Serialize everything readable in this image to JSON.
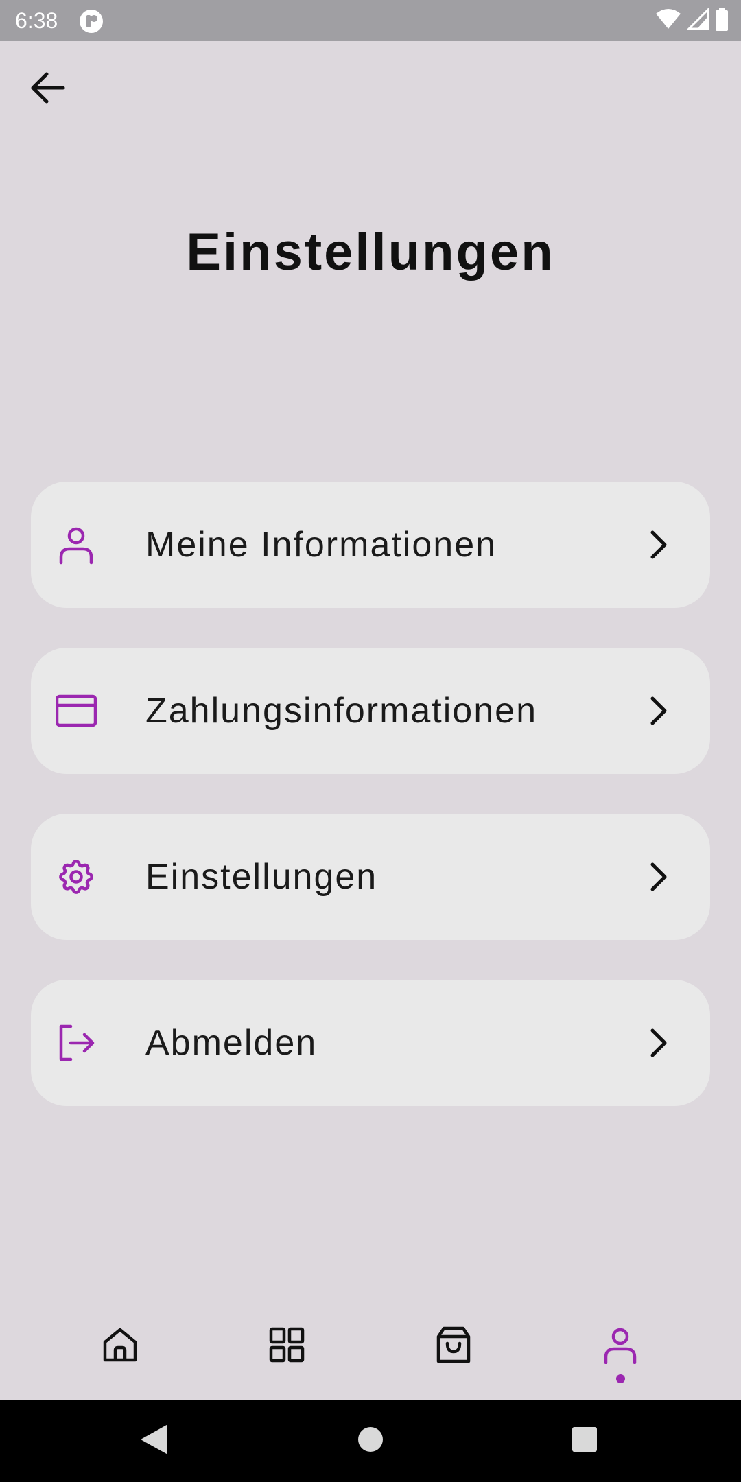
{
  "status_bar": {
    "time": "6:38",
    "icons": [
      "app-notification-icon",
      "wifi-icon",
      "signal-icon",
      "battery-icon"
    ]
  },
  "header": {
    "back_icon": "arrow-left-icon",
    "title": "Einstellungen"
  },
  "menu": {
    "items": [
      {
        "label": "Meine Informationen",
        "icon": "user-icon"
      },
      {
        "label": "Zahlungsinformationen",
        "icon": "credit-card-icon"
      },
      {
        "label": "Einstellungen",
        "icon": "gear-icon"
      },
      {
        "label": "Abmelden",
        "icon": "logout-icon"
      }
    ],
    "chevron_icon": "chevron-right-icon"
  },
  "bottom_nav": {
    "items": [
      {
        "icon": "home-icon",
        "active": false
      },
      {
        "icon": "grid-icon",
        "active": false
      },
      {
        "icon": "shopping-bag-icon",
        "active": false
      },
      {
        "icon": "user-icon",
        "active": true
      }
    ]
  },
  "system_nav": {
    "items": [
      "back-triangle-icon",
      "home-circle-icon",
      "recents-square-icon"
    ]
  },
  "colors": {
    "accent": "#9b27b0",
    "background": "#ddd8dd",
    "card": "#e9e9e9",
    "status_bar": "#a09fa3",
    "text": "#111111"
  }
}
